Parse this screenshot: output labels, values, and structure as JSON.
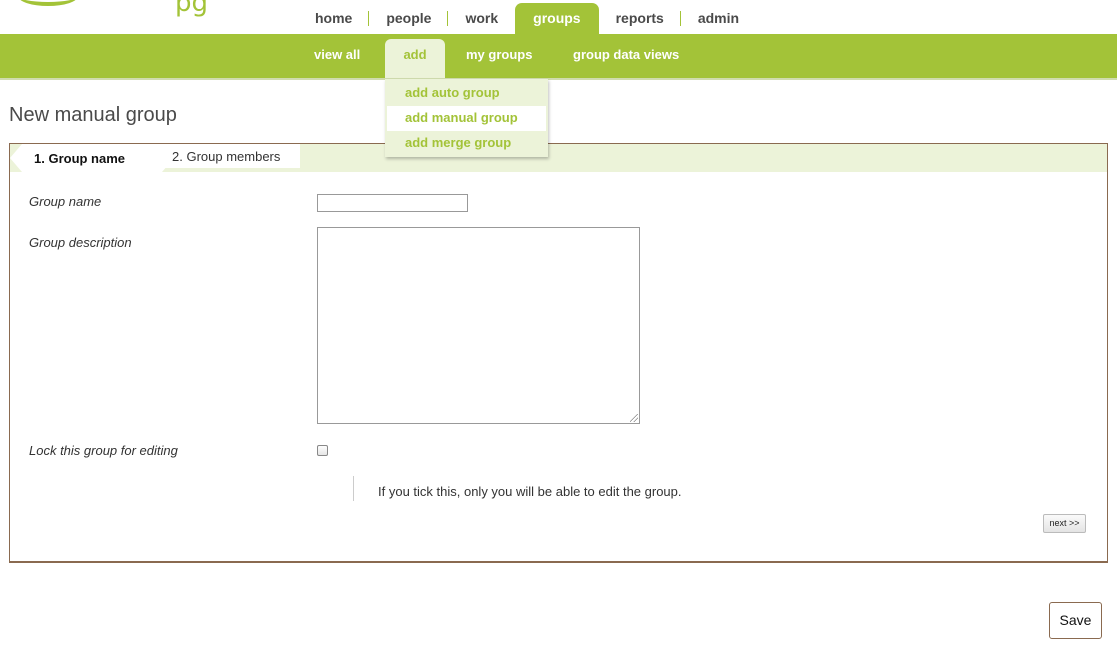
{
  "header": {
    "logo_text": "pg",
    "nav": [
      "home",
      "people",
      "work",
      "groups",
      "reports",
      "admin"
    ],
    "active_nav": "groups"
  },
  "subnav": {
    "items": [
      "view all",
      "add",
      "my groups",
      "group data views"
    ],
    "active": "add"
  },
  "dropdown": {
    "items": [
      "add auto group",
      "add manual group",
      "add merge group"
    ],
    "highlighted": "add manual group"
  },
  "page": {
    "title": "New manual group"
  },
  "wizard": {
    "steps": [
      "1. Group name",
      "2. Group members"
    ],
    "current_step": 1,
    "fields": {
      "group_name_label": "Group name",
      "group_name_value": "",
      "group_description_label": "Group description",
      "group_description_value": "",
      "lock_label": "Lock this group for editing",
      "lock_checked": false,
      "lock_help": "If you tick this, only you will be able to edit the group."
    },
    "next_label": "next >>"
  },
  "footer": {
    "save_label": "Save"
  },
  "colors": {
    "brand_green": "#a3c338",
    "light_green": "#ecf3d9",
    "border_brown": "#8a6a50"
  }
}
